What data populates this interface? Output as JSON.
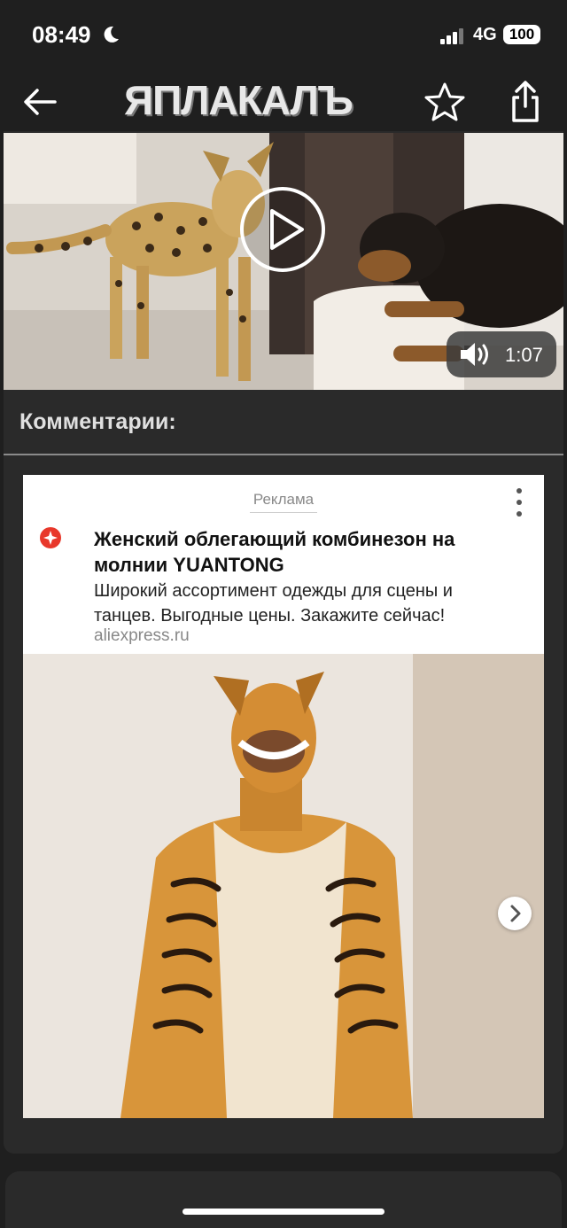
{
  "status": {
    "time": "08:49",
    "network": "4G",
    "battery": "100"
  },
  "header": {
    "logo_text": "ЯПЛАКАЛЪ",
    "icons": [
      "back-arrow-icon",
      "star-icon",
      "share-icon"
    ]
  },
  "video": {
    "duration": "1:07",
    "icons": [
      "play-icon",
      "volume-icon"
    ]
  },
  "comments": {
    "title": "Комментарии:"
  },
  "ad": {
    "label": "Реклама",
    "title": "Женский облегающий комбинезон на молнии YUANTONG",
    "description": "Широкий ассортимент одежды для сцены и танцев. Выгодные цены. Закажите сейчас!",
    "domain": "aliexpress.ru",
    "brand_color": "#e8382b"
  },
  "colors": {
    "background": "#1f1f1f",
    "card": "#2a2a2a"
  }
}
